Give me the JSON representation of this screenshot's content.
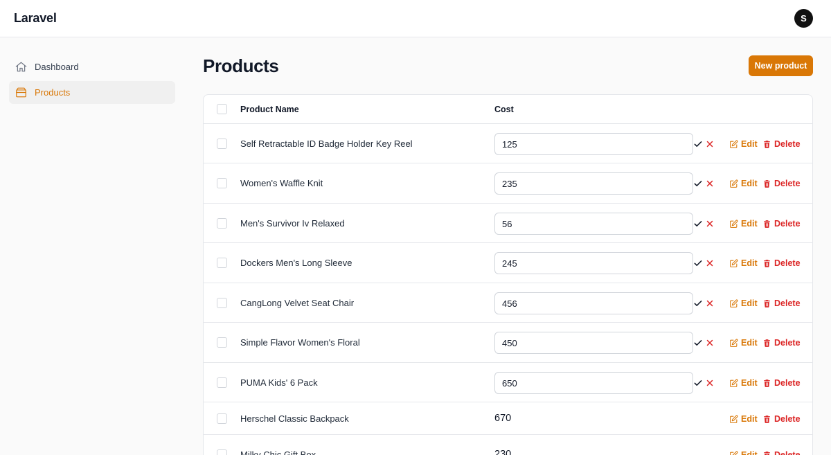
{
  "app": {
    "brand": "Laravel",
    "user_initial": "S"
  },
  "sidebar": {
    "items": [
      {
        "label": "Dashboard",
        "icon": "home-icon",
        "active": false
      },
      {
        "label": "Products",
        "icon": "archive-box-icon",
        "active": true
      }
    ]
  },
  "page": {
    "title": "Products",
    "new_button_label": "New product"
  },
  "table": {
    "columns": [
      "Product Name",
      "Cost"
    ],
    "actions": {
      "edit_label": "Edit",
      "delete_label": "Delete"
    },
    "rows": [
      {
        "name": "Self Retractable ID Badge Holder Key Reel",
        "cost": "125",
        "editing": true
      },
      {
        "name": "Women's Waffle Knit",
        "cost": "235",
        "editing": true
      },
      {
        "name": "Men's Survivor Iv Relaxed",
        "cost": "56",
        "editing": true
      },
      {
        "name": "Dockers Men's Long Sleeve",
        "cost": "245",
        "editing": true
      },
      {
        "name": "CangLong Velvet Seat Chair",
        "cost": "456",
        "editing": true
      },
      {
        "name": "Simple Flavor Women's Floral",
        "cost": "450",
        "editing": true
      },
      {
        "name": "PUMA Kids' 6 Pack",
        "cost": "650",
        "editing": true
      },
      {
        "name": "Herschel Classic Backpack",
        "cost": "670",
        "editing": false
      },
      {
        "name": "Milky Chic Gift Box",
        "cost": "230",
        "editing": false
      }
    ]
  },
  "colors": {
    "accent": "#d97706",
    "danger": "#dc2626",
    "active_nav_bg": "#f0f0f0",
    "text": "#111827"
  }
}
